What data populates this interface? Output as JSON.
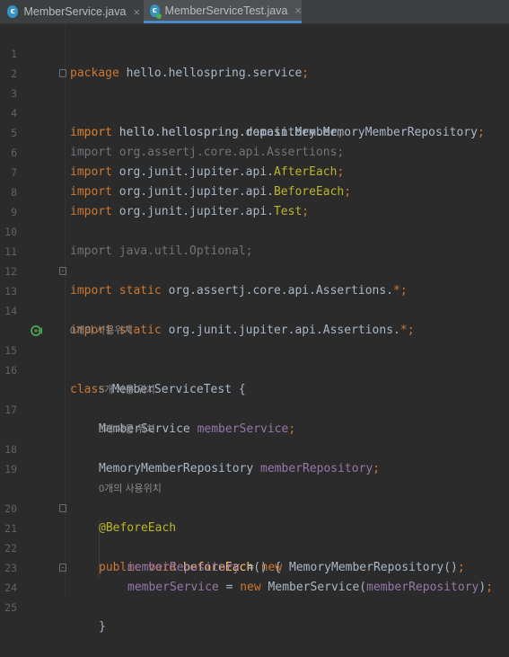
{
  "tabs": [
    {
      "label": "MemberService.java",
      "icon": "java-class-icon",
      "icon_letter": "c",
      "close": "×"
    },
    {
      "label": "MemberServiceTest.java",
      "icon": "java-test-class-icon",
      "icon_letter": "c",
      "close": "×"
    }
  ],
  "colors": {
    "background": "#2b2b2b",
    "keyword": "#cc7832",
    "plain": "#a9b7c6",
    "field": "#9876aa",
    "annotation": "#bbb529",
    "method": "#ffc66d",
    "unused_import": "#72737a",
    "line_number": "#606366"
  },
  "line_numbers": [
    "1",
    "2",
    "3",
    "4",
    "5",
    "6",
    "7",
    "8",
    "9",
    "10",
    "11",
    "12",
    "13",
    "14",
    "15",
    "16",
    "17",
    "18",
    "19",
    "20",
    "21",
    "22",
    "23",
    "24",
    "25"
  ],
  "hints": {
    "class_usages": "0개의 사용위치",
    "member_service_usages": "5개 사용 위치",
    "member_repository_usages": "3개 사용 위치",
    "before_each_usages": "0개의 사용위치"
  },
  "code": {
    "l1": {
      "kw": "package",
      "rest": " hello.hellospring.service",
      "semi": ";"
    },
    "l3": {
      "kw": "import",
      "rest": " hello.hellospring.domain.Member",
      "semi": ";"
    },
    "l4": {
      "kw": "import",
      "rest": " hello.hellospring.repository.MemoryMemberRepository",
      "semi": ";"
    },
    "l5": {
      "text": "import org.assertj.core.api.Assertions;"
    },
    "l6": {
      "kw": "import",
      "rest": " org.junit.jupiter.api.",
      "ann": "AfterEach",
      "semi": ";"
    },
    "l7": {
      "kw": "import",
      "rest": " org.junit.jupiter.api.",
      "ann": "BeforeEach",
      "semi": ";"
    },
    "l8": {
      "kw": "import",
      "rest": " org.junit.jupiter.api.",
      "ann": "Test",
      "semi": ";"
    },
    "l10": {
      "text": "import java.util.Optional;"
    },
    "l12": {
      "kw": "import static",
      "rest": " org.assertj.core.api.Assertions.",
      "star": "*",
      "semi": ";"
    },
    "l13": {
      "kw": "import static",
      "rest": " org.junit.jupiter.api.Assertions.",
      "star": "*",
      "semi": ";"
    },
    "l15": {
      "kw": "class",
      "rest": " MemberServiceTest {"
    },
    "l17": {
      "type": "MemberService ",
      "field": "memberService",
      "semi": ";"
    },
    "l18": {
      "type": "MemoryMemberRepository ",
      "field": "memberRepository",
      "semi": ";"
    },
    "l20": {
      "ann": "@BeforeEach"
    },
    "l21": {
      "kw": "public void ",
      "fn": "beforeEach",
      "rest": "() {"
    },
    "l22": {
      "field": "memberRepository",
      "eq": " = ",
      "kw": "new",
      "rest": " MemoryMemberRepository()",
      "semi": ";"
    },
    "l23": {
      "field": "memberService",
      "eq": " = ",
      "kw": "new",
      "rest": " MemberService(",
      "arg": "memberRepository",
      "close": ")",
      "semi": ";"
    },
    "l24": {
      "text": "}"
    }
  }
}
